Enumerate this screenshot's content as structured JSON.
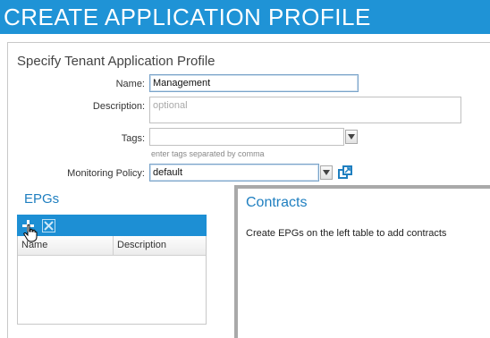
{
  "header": {
    "title": "CREATE APPLICATION PROFILE"
  },
  "form": {
    "section_title": "Specify Tenant Application Profile",
    "name": {
      "label": "Name:",
      "value": "Management"
    },
    "description": {
      "label": "Description:",
      "placeholder": "optional"
    },
    "tags": {
      "label": "Tags:",
      "value": "",
      "hint": "enter tags separated by comma"
    },
    "monitoring_policy": {
      "label": "Monitoring Policy:",
      "value": "default"
    }
  },
  "epgs": {
    "title": "EPGs",
    "columns": [
      "Name",
      "Description"
    ],
    "rows": []
  },
  "contracts": {
    "title": "Contracts",
    "message": "Create EPGs on the left table to add contracts"
  },
  "icons": {
    "add": "plus-icon",
    "delete": "delete-x-icon",
    "open": "open-external-icon",
    "dropdown": "chevron-down-icon",
    "cursor": "hand-cursor-icon"
  },
  "colors": {
    "header_bg": "#1f93d6",
    "accent": "#1f7fc0",
    "toolbar_bg": "#1d8fd4"
  }
}
